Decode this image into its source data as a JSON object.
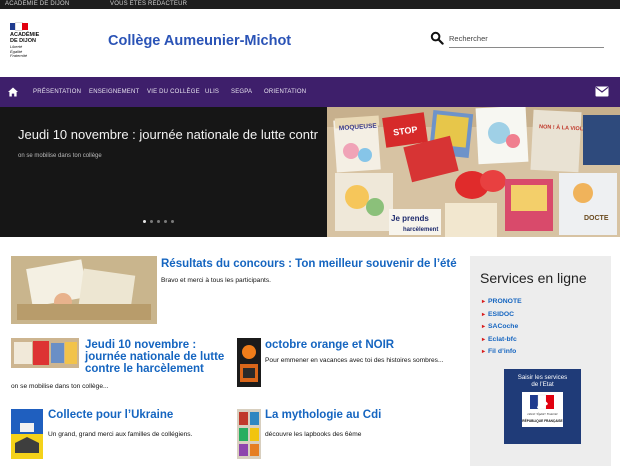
{
  "topbar": {
    "left": "ACADÉMIE DE DIJON",
    "right": "VOUS ÊTES RÉDACTEUR"
  },
  "logo": {
    "lines": [
      "ACADÉMIE",
      "DE DIJON"
    ],
    "motto": [
      "Liberté",
      "Égalité",
      "Fraternité"
    ]
  },
  "site_title": "Collège Aumeunier-Michot",
  "search": {
    "placeholder": "Rechercher"
  },
  "nav": {
    "items": [
      "PRÉSENTATION",
      "ENSEIGNEMENT",
      "VIE DU COLLÈGE",
      "ULIS",
      "SEGPA",
      "ORIENTATION"
    ]
  },
  "hero": {
    "title": "Jeudi 10 novembre : journée nationale de lutte contr...",
    "subtitle": "on se mobilise dans ton collège",
    "slides_count": 5,
    "active_slide": 1,
    "image_words": {
      "stop": "STOP",
      "moqueuse": "MOQUEUSE",
      "jeprends": "Je prends",
      "harcelement": "harcèlement",
      "violence": "NON ! À LA VIOLENCE",
      "doctor": "DOCTE"
    }
  },
  "articles": [
    {
      "title": "Résultats du concours : Ton meilleur souvenir de l’été",
      "text": "Bravo et merci à tous les participants."
    },
    {
      "title": "Jeudi 10 novembre : journée nationale de lutte contre le harcèlement",
      "text": "on se mobilise dans ton collège..."
    },
    {
      "title": "octobre orange et NOIR",
      "text": "Pour emmener en vacances avec toi des histoires sombres..."
    },
    {
      "title": "Collecte pour l’Ukraine",
      "text": "Un grand, grand merci aux familles de collégiens."
    },
    {
      "title": "La mythologie au Cdi",
      "text": "découvre les lapbooks des 6ème"
    }
  ],
  "aside": {
    "title": "Services en ligne",
    "links": [
      "PRONOTE",
      "ESIDOC",
      "SACoche",
      "Eclat-bfc",
      "Fil d’info"
    ],
    "etat_banner": {
      "line1": "Saisir les services",
      "line2": "de l’Etat",
      "motto": "Liberté • Égalité • Fraternité",
      "rf": "RÉPUBLIQUE FRANÇAISE"
    }
  },
  "colors": {
    "nav_bg": "#3e1f6b",
    "title_blue": "#2a53b6",
    "link_blue": "#1565c0",
    "hero_bg": "#161616"
  }
}
